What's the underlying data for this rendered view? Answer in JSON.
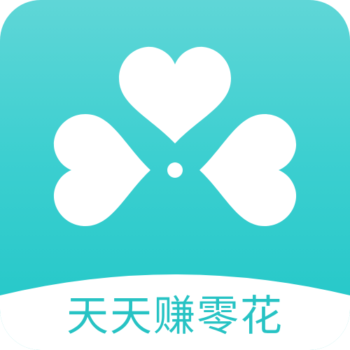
{
  "app": {
    "name": "天天赚零花"
  },
  "colors": {
    "background_top": "#5fd6d7",
    "background_bottom": "#20c6c7",
    "clover": "#ffffff",
    "banner": "#ffffff",
    "title_text": "#27c3c4"
  },
  "icons": {
    "logo": "clover-heart-icon"
  }
}
